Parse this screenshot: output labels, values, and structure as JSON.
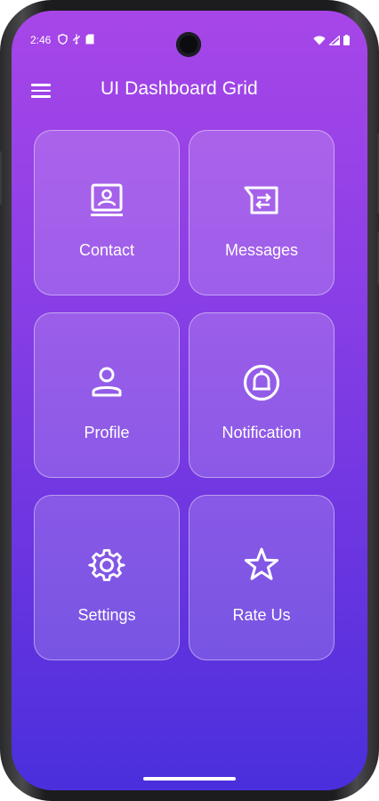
{
  "status_bar": {
    "time": "2:46",
    "left_icons": [
      "shield-icon",
      "usb-icon",
      "sd-card-icon"
    ],
    "right_icons": [
      "wifi-icon",
      "signal-icon",
      "battery-icon"
    ]
  },
  "app_bar": {
    "menu_icon": "menu-icon",
    "title": "UI Dashboard Grid"
  },
  "tiles": [
    {
      "label": "Contact",
      "icon": "contact-card-icon"
    },
    {
      "label": "Messages",
      "icon": "messages-swap-icon"
    },
    {
      "label": "Profile",
      "icon": "person-icon"
    },
    {
      "label": "Notification",
      "icon": "bell-icon"
    },
    {
      "label": "Settings",
      "icon": "gear-icon"
    },
    {
      "label": "Rate Us",
      "icon": "star-icon"
    }
  ],
  "colors": {
    "gradient_top": "#a746e8",
    "gradient_bottom": "#4a2fdc",
    "text": "#ffffff"
  }
}
